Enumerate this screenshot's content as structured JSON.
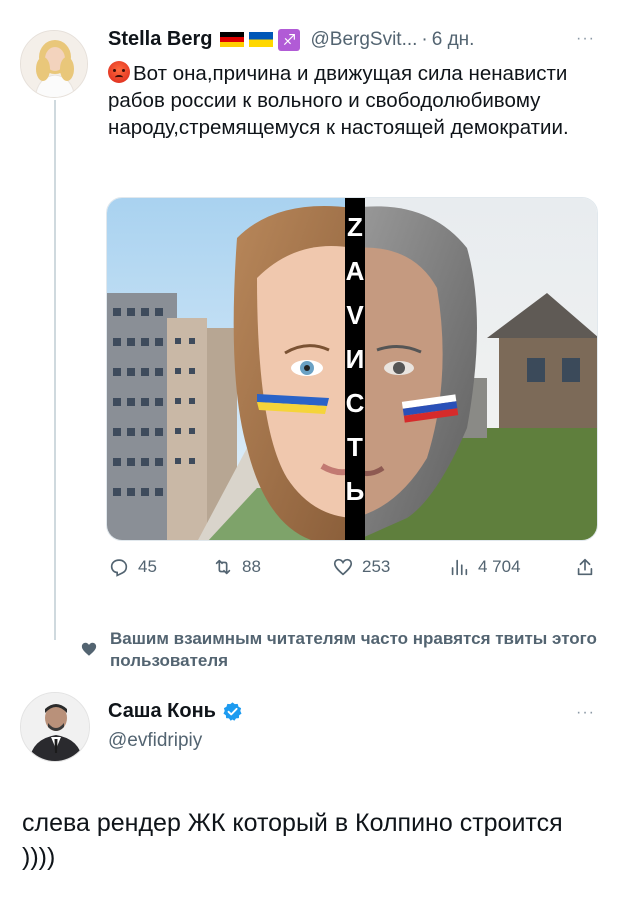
{
  "tweet": {
    "author_name": "Stella Berg",
    "handle": "@BergSvit...",
    "separator": "·",
    "time": "6 дн.",
    "more_label": "···",
    "text": "Вот она,причина и движущая сила ненависти рабов россии к вольного и свободолюбивому народу,стремящемуся к настоящей демократии.",
    "emoji": "angry-face-icon",
    "flags": [
      "flag-germany-icon",
      "flag-ukraine-icon",
      "sagittarius-icon"
    ],
    "sagittarius_glyph": "♐",
    "image": {
      "center_letters": [
        "Z",
        "А",
        "V",
        "И",
        "С",
        "Т",
        "Ь"
      ]
    },
    "actions": {
      "replies": "45",
      "retweets": "88",
      "likes": "253",
      "views": "4 704"
    }
  },
  "social_context": {
    "text": "Вашим взаимным читателям часто нравятся твиты этого пользователя"
  },
  "reply_user": {
    "name": "Саша Конь",
    "handle": "@evfidripiy",
    "more_label": "···"
  },
  "reply_text": "слева рендер ЖК который в Колпино строится ))))",
  "colors": {
    "text_primary": "#0f1419",
    "text_secondary": "#536471",
    "verified_blue": "#1d9bf0",
    "divider": "#cfd9de"
  }
}
